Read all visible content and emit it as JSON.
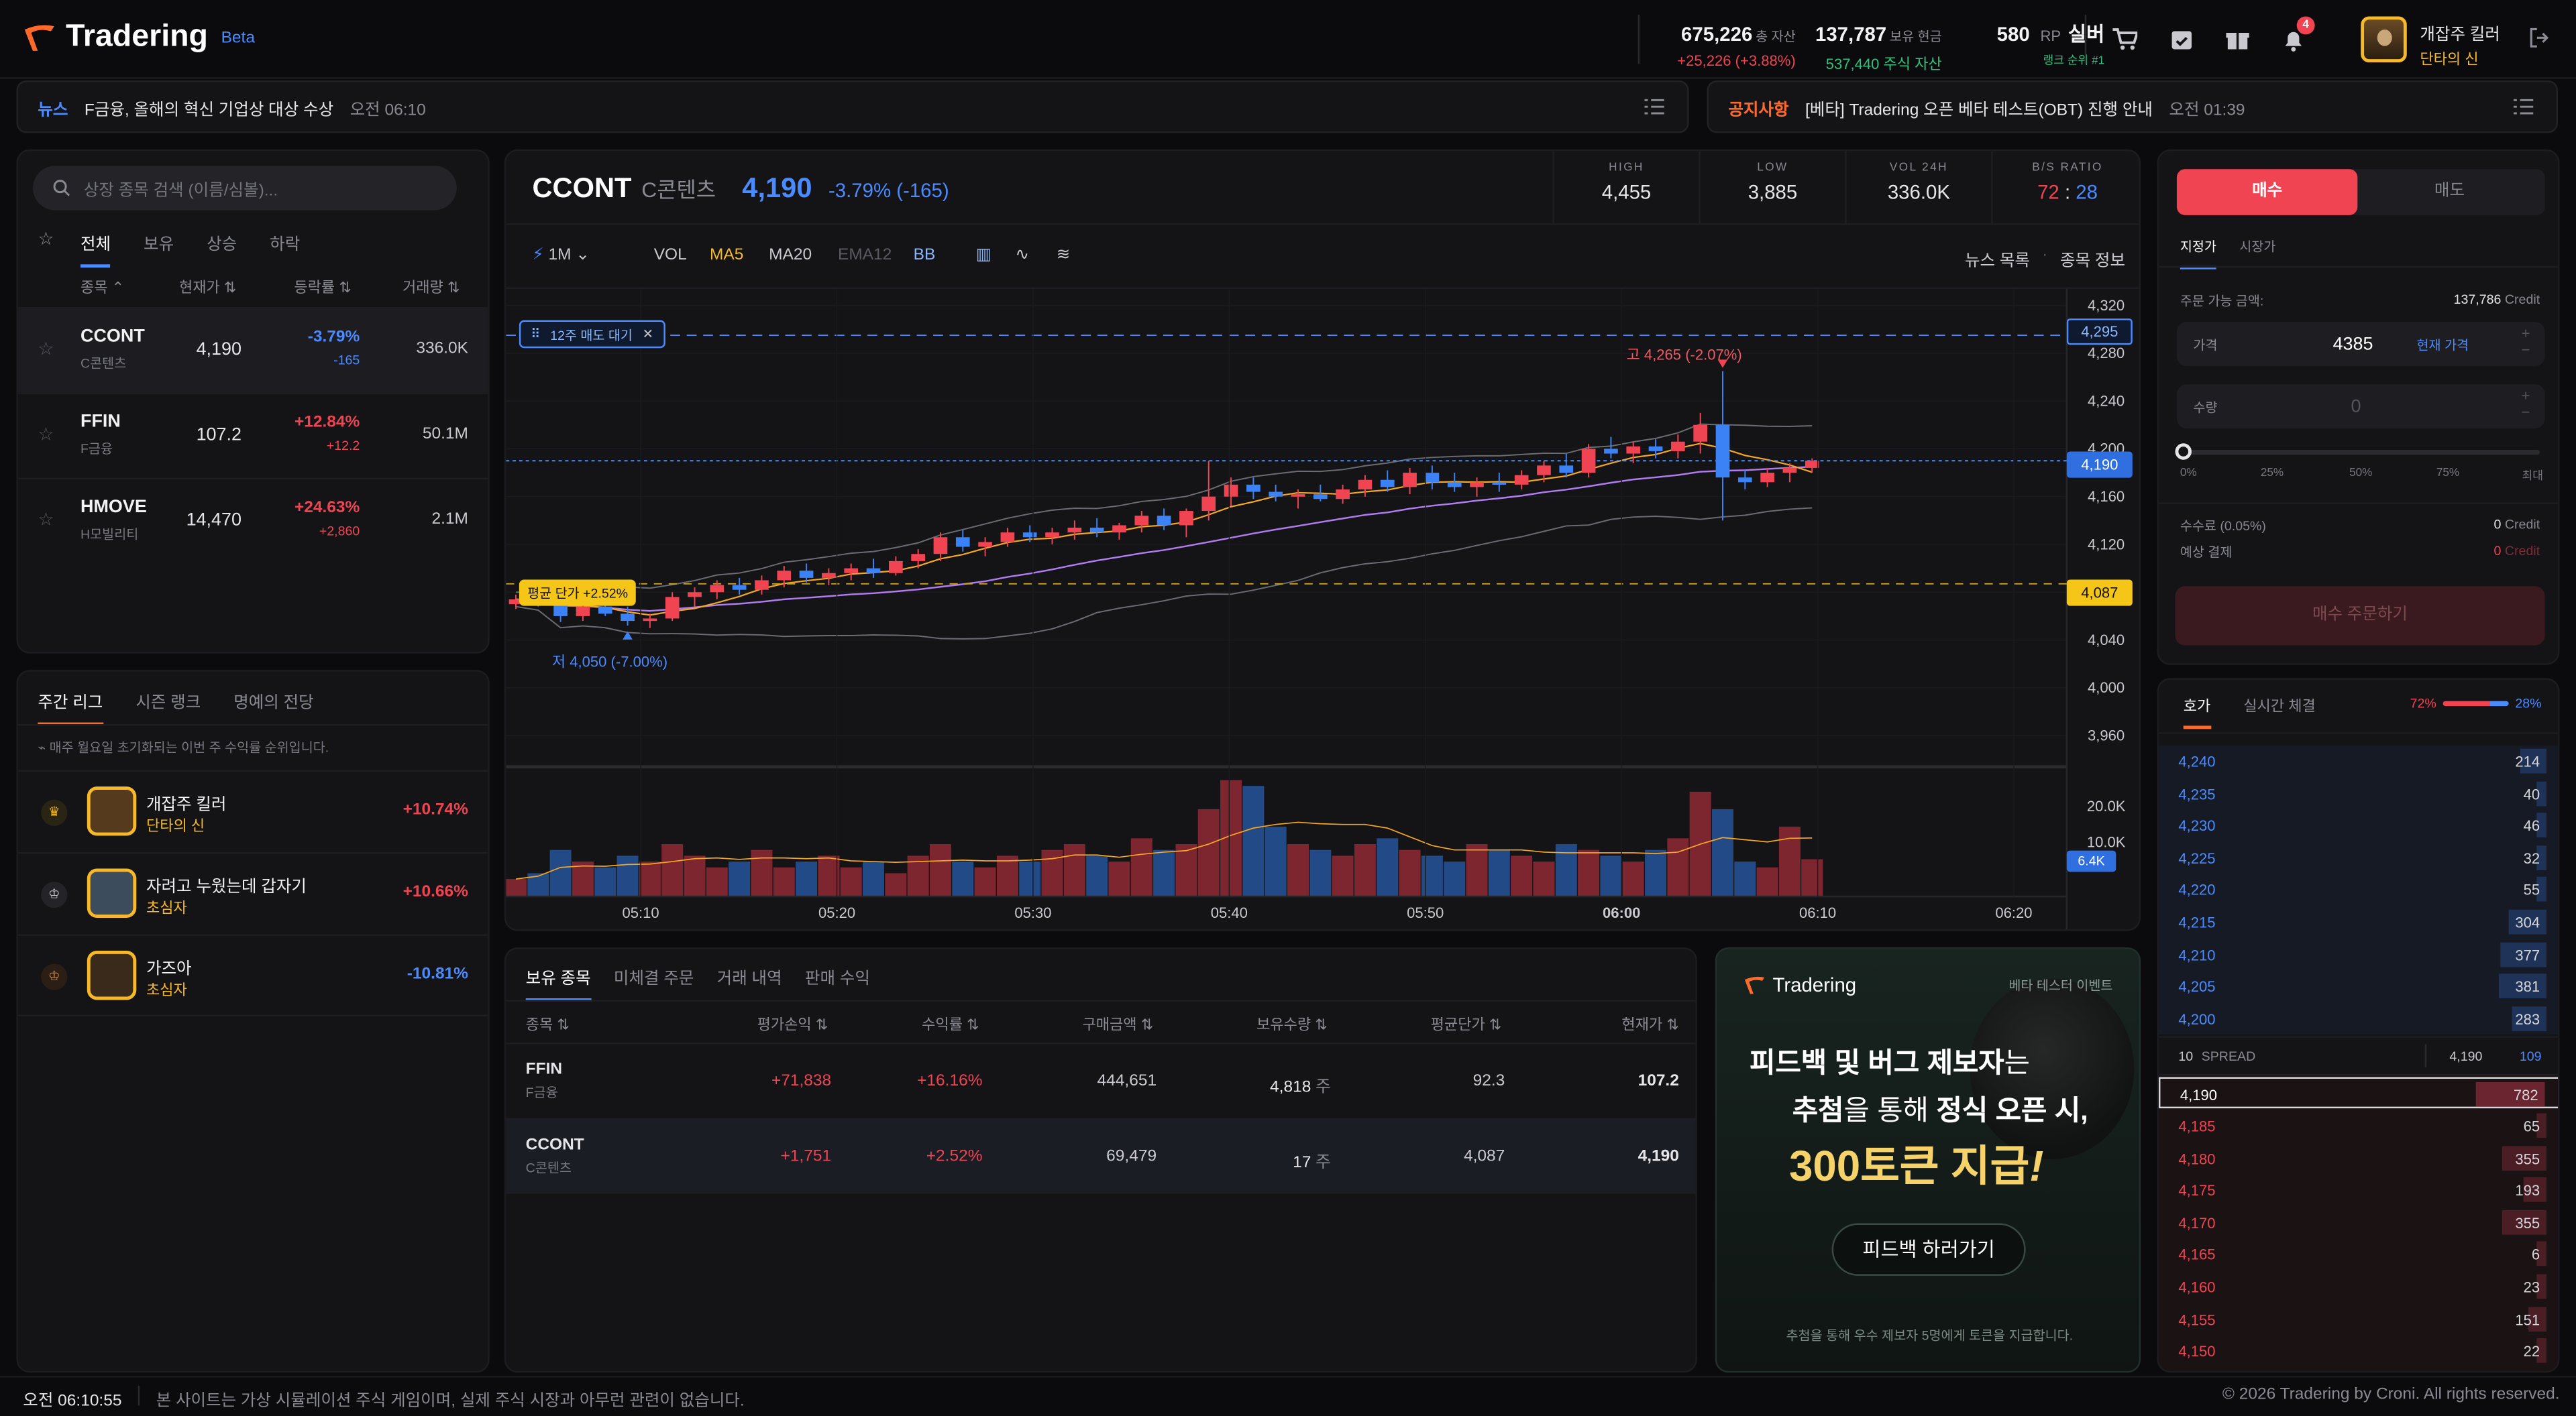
{
  "app": {
    "name": "Tradering",
    "badge": "Beta"
  },
  "header": {
    "total_assets": {
      "value": "675,226",
      "label": "총 자산",
      "sub": "+25,226 (+3.88%)"
    },
    "cash": {
      "value": "137,787",
      "label": "보유 현금",
      "sub": "537,440 주식 자산"
    },
    "rp": {
      "value": "580",
      "unit": "RP",
      "tier": "실버",
      "sub": "랭크 순위 #1"
    },
    "notifications": "4",
    "user": {
      "name": "개잡주 킬러",
      "title": "단타의 신"
    },
    "icons": [
      "cart-icon",
      "calendar-icon",
      "gift-icon",
      "bell-icon",
      "logout-icon"
    ]
  },
  "news": {
    "tag": "뉴스",
    "text": "F금융, 올해의 혁신 기업상 대상 수상",
    "time": "오전 06:10"
  },
  "notice": {
    "tag": "공지사항",
    "text": "[베타] Tradering 오픈 베타 테스트(OBT) 진행 안내",
    "time": "오전 01:39"
  },
  "stock_list": {
    "search_placeholder": "상장 종목 검색 (이름/심볼)...",
    "tabs": [
      "전체",
      "보유",
      "상승",
      "하락"
    ],
    "headers": [
      "종목",
      "현재가",
      "등락률",
      "거래량"
    ],
    "rows": [
      {
        "symbol": "CCONT",
        "name": "C콘텐츠",
        "price": "4,190",
        "change": "-3.79%",
        "diff": "-165",
        "volume": "336.0K",
        "dir": "down"
      },
      {
        "symbol": "FFIN",
        "name": "F금융",
        "price": "107.2",
        "change": "+12.84%",
        "diff": "+12.2",
        "volume": "50.1M",
        "dir": "up"
      },
      {
        "symbol": "HMOVE",
        "name": "H모빌리티",
        "price": "14,470",
        "change": "+24.63%",
        "diff": "+2,860",
        "volume": "2.1M",
        "dir": "up"
      }
    ]
  },
  "league": {
    "tabs": [
      "주간 리그",
      "시즌 랭크",
      "명예의 전당"
    ],
    "note": "매주 월요일 초기화되는 이번 주 수익률 순위입니다.",
    "rows": [
      {
        "name": "개잡주 킬러",
        "title": "단타의 신",
        "pct": "+10.74%",
        "dir": "up"
      },
      {
        "name": "자려고 누웠는데 갑자기",
        "title": "초심자",
        "pct": "+10.66%",
        "dir": "up"
      },
      {
        "name": "가즈아",
        "title": "초심자",
        "pct": "-10.81%",
        "dir": "down"
      }
    ]
  },
  "chart_header": {
    "symbol": "CCONT",
    "name": "C콘텐츠",
    "price": "4,190",
    "change": "-3.79% (-165)",
    "stats": [
      {
        "label": "HIGH",
        "value": "4,455"
      },
      {
        "label": "LOW",
        "value": "3,885"
      },
      {
        "label": "VOL 24H",
        "value": "336.0K"
      }
    ],
    "ratio_label": "B/S RATIO",
    "ratio_buy": "72",
    "ratio_sell": "28"
  },
  "toolbar": {
    "interval": "1M",
    "indicators": [
      "VOL",
      "MA5",
      "MA20",
      "EMA12",
      "BB"
    ],
    "links": [
      "뉴스 목록",
      "종목 정보"
    ]
  },
  "chart_data": {
    "type": "candlestick",
    "y_ticks": [
      "4,320",
      "4,280",
      "4,240",
      "4,200",
      "4,160",
      "4,120",
      "4,080",
      "4,040",
      "4,000",
      "3,960"
    ],
    "x_ticks": [
      "05:10",
      "05:20",
      "05:30",
      "05:40",
      "05:50",
      "06:00",
      "06:10",
      "06:20"
    ],
    "vol_ticks": [
      "20.0K",
      "10.0K"
    ],
    "ylim": [
      3960,
      4320
    ],
    "labels": {
      "pending_order": "12주 매도 대기",
      "pending_price": "4,295",
      "current": "4,190",
      "avg_label": "평균 단가 +2.52%",
      "avg_price": "4,087",
      "high_marker": "고 4,265 (-2.07%)",
      "low_marker": "저 4,050 (-7.00%)",
      "last_volume": "6.4K"
    },
    "candles": [
      [
        4070,
        4078,
        4066,
        4074
      ],
      [
        4074,
        4080,
        4068,
        4072
      ],
      [
        4072,
        4074,
        4055,
        4060
      ],
      [
        4060,
        4072,
        4056,
        4068
      ],
      [
        4068,
        4073,
        4060,
        4062
      ],
      [
        4062,
        4068,
        4052,
        4056
      ],
      [
        4056,
        4062,
        4050,
        4058
      ],
      [
        4058,
        4080,
        4056,
        4076
      ],
      [
        4076,
        4084,
        4068,
        4080
      ],
      [
        4080,
        4090,
        4074,
        4086
      ],
      [
        4086,
        4092,
        4078,
        4082
      ],
      [
        4082,
        4094,
        4078,
        4090
      ],
      [
        4090,
        4102,
        4084,
        4098
      ],
      [
        4098,
        4104,
        4088,
        4092
      ],
      [
        4092,
        4100,
        4086,
        4096
      ],
      [
        4096,
        4104,
        4090,
        4100
      ],
      [
        4100,
        4108,
        4092,
        4096
      ],
      [
        4096,
        4110,
        4094,
        4106
      ],
      [
        4106,
        4116,
        4100,
        4112
      ],
      [
        4112,
        4130,
        4106,
        4126
      ],
      [
        4126,
        4132,
        4114,
        4118
      ],
      [
        4118,
        4126,
        4110,
        4122
      ],
      [
        4122,
        4134,
        4118,
        4130
      ],
      [
        4130,
        4136,
        4122,
        4126
      ],
      [
        4126,
        4134,
        4120,
        4130
      ],
      [
        4130,
        4140,
        4124,
        4134
      ],
      [
        4134,
        4142,
        4126,
        4130
      ],
      [
        4130,
        4138,
        4124,
        4136
      ],
      [
        4136,
        4148,
        4130,
        4144
      ],
      [
        4144,
        4150,
        4132,
        4136
      ],
      [
        4136,
        4150,
        4126,
        4148
      ],
      [
        4148,
        4190,
        4140,
        4160
      ],
      [
        4160,
        4176,
        4152,
        4170
      ],
      [
        4170,
        4176,
        4158,
        4164
      ],
      [
        4164,
        4170,
        4156,
        4160
      ],
      [
        4160,
        4166,
        4150,
        4162
      ],
      [
        4162,
        4170,
        4156,
        4158
      ],
      [
        4158,
        4170,
        4154,
        4166
      ],
      [
        4166,
        4178,
        4160,
        4174
      ],
      [
        4174,
        4182,
        4164,
        4168
      ],
      [
        4168,
        4184,
        4162,
        4180
      ],
      [
        4180,
        4186,
        4166,
        4172
      ],
      [
        4172,
        4180,
        4164,
        4168
      ],
      [
        4168,
        4176,
        4160,
        4172
      ],
      [
        4172,
        4180,
        4164,
        4170
      ],
      [
        4170,
        4182,
        4166,
        4178
      ],
      [
        4178,
        4190,
        4172,
        4186
      ],
      [
        4186,
        4196,
        4176,
        4180
      ],
      [
        4180,
        4204,
        4176,
        4200
      ],
      [
        4200,
        4210,
        4192,
        4196
      ],
      [
        4196,
        4206,
        4188,
        4202
      ],
      [
        4202,
        4208,
        4192,
        4198
      ],
      [
        4198,
        4212,
        4192,
        4206
      ],
      [
        4206,
        4230,
        4196,
        4220
      ],
      [
        4220,
        4265,
        4140,
        4176
      ],
      [
        4176,
        4182,
        4166,
        4172
      ],
      [
        4172,
        4184,
        4168,
        4180
      ],
      [
        4180,
        4188,
        4172,
        4184
      ],
      [
        4184,
        4192,
        4180,
        4190
      ]
    ],
    "volumes": [
      3,
      4,
      8,
      6,
      5,
      7,
      6,
      9,
      7,
      5,
      6,
      8,
      5,
      6,
      7,
      5,
      6,
      4,
      7,
      9,
      6,
      5,
      7,
      6,
      8,
      9,
      7,
      6,
      10,
      8,
      9,
      15,
      20,
      19,
      12,
      9,
      8,
      7,
      9,
      10,
      8,
      7,
      6,
      9,
      8,
      7,
      6,
      9,
      8,
      7,
      6,
      8,
      10,
      18,
      15,
      6,
      5,
      12,
      6.4
    ]
  },
  "holdings": {
    "tabs": [
      "보유 종목",
      "미체결 주문",
      "거래 내역",
      "판매 수익"
    ],
    "headers": [
      "종목",
      "평가손익",
      "수익률",
      "구매금액",
      "보유수량",
      "평균단가",
      "현재가"
    ],
    "rows": [
      {
        "symbol": "FFIN",
        "name": "F금융",
        "pnl": "+71,838",
        "pct": "+16.16%",
        "cost": "444,651",
        "qty": "4,818",
        "unit": "주",
        "avg": "92.3",
        "price": "107.2"
      },
      {
        "symbol": "CCONT",
        "name": "C콘텐츠",
        "pnl": "+1,751",
        "pct": "+2.52%",
        "cost": "69,479",
        "qty": "17",
        "unit": "주",
        "avg": "4,087",
        "price": "4,190"
      }
    ]
  },
  "promo": {
    "brand": "Tradering",
    "event": "베타 테스터 이벤트",
    "line1a": "피드백 및 버그 제보자",
    "line1b": "는",
    "line2a": "추첨",
    "line2b": "을 통해 ",
    "line2c": "정식 오픈 시,",
    "line3": "300토큰 지급",
    "line3_excl": "!",
    "button": "피드백 하러가기",
    "footnote": "추첨을 통해 우수 제보자 5명에게 토큰을 지급합니다."
  },
  "order": {
    "buy": "매수",
    "sell": "매도",
    "type_tabs": [
      "지정가",
      "시장가"
    ],
    "available_label": "주문 가능 금액:",
    "available_value": "137,786",
    "credit": "Credit",
    "price_label": "가격",
    "price_value": "4385",
    "price_link": "현재 가격",
    "qty_label": "수량",
    "qty_value": "0",
    "slider_marks": [
      "0%",
      "25%",
      "50%",
      "75%",
      "최대"
    ],
    "fee_label": "수수료 (0.05%)",
    "fee_value": "0",
    "total_label": "예상 결제",
    "total_value": "0",
    "submit": "매수 주문하기"
  },
  "orderbook": {
    "tabs": [
      "호가",
      "실시간 체결"
    ],
    "ratio_buy": "72%",
    "ratio_sell": "28%",
    "asks": [
      [
        "4,240",
        "214"
      ],
      [
        "4,235",
        "40"
      ],
      [
        "4,230",
        "46"
      ],
      [
        "4,225",
        "32"
      ],
      [
        "4,220",
        "55"
      ],
      [
        "4,215",
        "304"
      ],
      [
        "4,210",
        "377"
      ],
      [
        "4,205",
        "381"
      ],
      [
        "4,200",
        "283"
      ]
    ],
    "spread": {
      "count": "10",
      "label": "SPREAD",
      "price": "4,190",
      "qty": "109"
    },
    "current": [
      "4,190",
      "782"
    ],
    "bids": [
      [
        "4,185",
        "65"
      ],
      [
        "4,180",
        "355"
      ],
      [
        "4,175",
        "193"
      ],
      [
        "4,170",
        "355"
      ],
      [
        "4,165",
        "6"
      ],
      [
        "4,160",
        "23"
      ],
      [
        "4,155",
        "151"
      ],
      [
        "4,150",
        "22"
      ]
    ]
  },
  "footer": {
    "time": "오전 06:10:55",
    "disclaimer": "본 사이트는 가상 시뮬레이션 주식 게임이며, 실제 주식 시장과 아무런 관련이 없습니다.",
    "copyright": "© 2026 Tradering by Croni. All rights reserved."
  }
}
